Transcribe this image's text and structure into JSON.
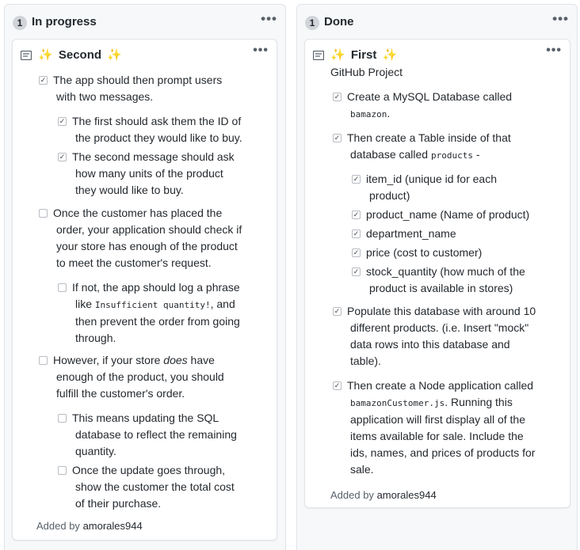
{
  "columns": [
    {
      "count": "1",
      "title": "In progress",
      "menu": "•••",
      "card": {
        "title": "Second",
        "sparkle": "✨",
        "menu": "•••",
        "added_prefix": "Added by",
        "added_user": "amorales944",
        "tasks": [
          {
            "checked": true,
            "lines": [
              "The app should then prompt users",
              "with two messages."
            ]
          },
          {
            "checked": true,
            "lines": [
              "The first should ask them the ID of",
              "the product they would like to buy."
            ]
          },
          {
            "checked": true,
            "lines": [
              "The second message should ask",
              "how many units of the product",
              "they would like to buy."
            ]
          },
          {
            "checked": false,
            "lines": [
              "Once the customer has placed the",
              "order, your application should check if",
              "your store has enough of the product",
              "to meet the customer's request."
            ]
          },
          {
            "checked": false,
            "line1_pre": "If not, the app should log a phrase",
            "line2_a": "like ",
            "line2_code": "Insufficient quantity!",
            "line2_b": ", and",
            "line3": "then prevent the order from going",
            "line4": "through."
          },
          {
            "checked": false,
            "line1_a": "However, if your store ",
            "line1_em": "does",
            "line1_b": " have",
            "line2": "enough of the product, you should",
            "line3": "fulfill the customer's order."
          },
          {
            "checked": false,
            "lines": [
              "This means updating the SQL",
              "database to reflect the remaining",
              "quantity."
            ]
          },
          {
            "checked": false,
            "lines": [
              "Once the update goes through,",
              "show the customer the total cost",
              "of their purchase."
            ]
          }
        ]
      }
    },
    {
      "count": "1",
      "title": "Done",
      "menu": "•••",
      "card": {
        "title": "First",
        "sparkle": "✨",
        "subtitle": "GitHub Project",
        "menu": "•••",
        "added_prefix": "Added by",
        "added_user": "amorales944",
        "tasks": [
          {
            "checked": true,
            "line1": "Create a MySQL Database called",
            "line2_code": "bamazon",
            "line2_b": "."
          },
          {
            "checked": true,
            "line1": "Then create a Table inside of that",
            "line2_a": "database called ",
            "line2_code": "products",
            "line2_b": " -"
          },
          {
            "checked": true,
            "lines": [
              "item_id (unique id for each",
              "product)"
            ]
          },
          {
            "checked": true,
            "lines": [
              "product_name (Name of product)"
            ]
          },
          {
            "checked": true,
            "lines": [
              "department_name"
            ]
          },
          {
            "checked": true,
            "lines": [
              "price (cost to customer)"
            ]
          },
          {
            "checked": true,
            "lines": [
              "stock_quantity (how much of the",
              "product is available in stores)"
            ]
          },
          {
            "checked": true,
            "lines": [
              "Populate this database with around 10",
              "different products. (i.e. Insert \"mock\"",
              "data rows into this database and",
              "table)."
            ]
          },
          {
            "checked": true,
            "line1": "Then create a Node application called",
            "line2_code": "bamazonCustomer.js",
            "line2_b": ". Running this",
            "rest": [
              "application will first display all of the",
              "items available for sale. Include the",
              "ids, names, and prices of products for",
              "sale."
            ]
          }
        ]
      }
    }
  ]
}
